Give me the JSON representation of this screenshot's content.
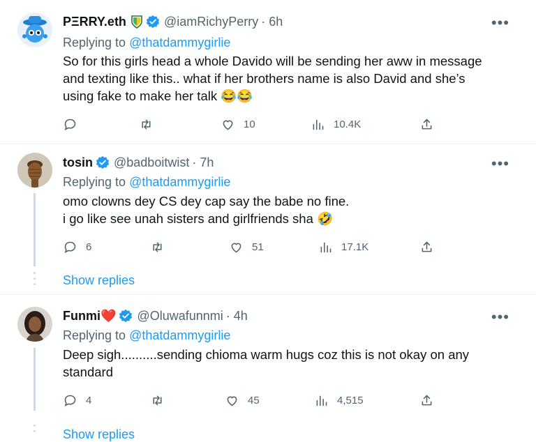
{
  "tweets": [
    {
      "name": "PΞRRY.eth",
      "handle": "@iamRichyPerry",
      "time": "· 6h",
      "replying_prefix": "Replying to",
      "replying_to": "@thatdammygirlie",
      "lines": [
        "So for this girls head a whole Davido will be sending her aww in message",
        "and texting like this.. what if her brothers name is also David and she’s",
        "using fake to make her talk 😂😂"
      ],
      "replies": "",
      "likes": "10",
      "views": "10.4K"
    },
    {
      "name": "tosin",
      "handle": "@badboitwist",
      "time": "· 7h",
      "replying_prefix": "Replying to",
      "replying_to": "@thatdammygirlie",
      "lines": [
        "omo clowns dey CS dey cap say the babe no fine.",
        "i go like see unah sisters and girlfriends sha 🤣"
      ],
      "replies": "6",
      "likes": "51",
      "views": "17.1K"
    },
    {
      "name": "Funmi",
      "heart": "❤️",
      "handle": "@Oluwafunnmi",
      "time": "· 4h",
      "replying_prefix": "Replying to",
      "replying_to": "@thatdammygirlie",
      "lines": [
        "Deep sigh..........sending chioma warm hugs coz this is not okay on any",
        "standard"
      ],
      "replies": "4",
      "likes": "45",
      "views": "4,515"
    }
  ],
  "show_replies": [
    "Show replies",
    "Show replies"
  ],
  "more_glyph": "•••",
  "colors": {
    "accent": "#1d9bf0",
    "muted": "#536471",
    "text": "#0f1419",
    "verified": "#1d9bf0"
  }
}
